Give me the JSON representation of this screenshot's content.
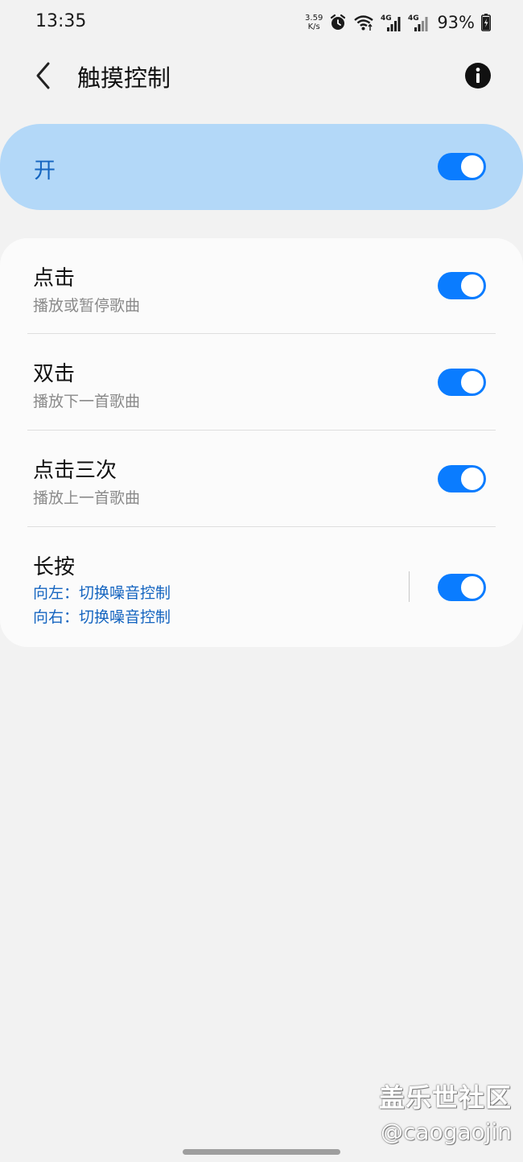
{
  "status_bar": {
    "time": "13:35",
    "net_speed_value": "3.59",
    "net_speed_unit": "K/s",
    "network_1": "4G",
    "network_2": "4G",
    "battery": "93%"
  },
  "header": {
    "title": "触摸控制"
  },
  "master": {
    "label": "开",
    "enabled": true
  },
  "settings": [
    {
      "title": "点击",
      "subtitle": "播放或暂停歌曲",
      "enabled": true
    },
    {
      "title": "双击",
      "subtitle": "播放下一首歌曲",
      "enabled": true
    },
    {
      "title": "点击三次",
      "subtitle": "播放上一首歌曲",
      "enabled": true
    },
    {
      "title": "长按",
      "left_action": "向左：切换噪音控制",
      "right_action": "向右：切换噪音控制",
      "enabled": true
    }
  ],
  "watermark": {
    "brand": "盖乐世社区",
    "user": "@caogaojin"
  },
  "colors": {
    "accent": "#0a7cff",
    "master_bg": "#b3d8f8",
    "link_blue": "#1565c0",
    "background": "#f2f2f2"
  }
}
